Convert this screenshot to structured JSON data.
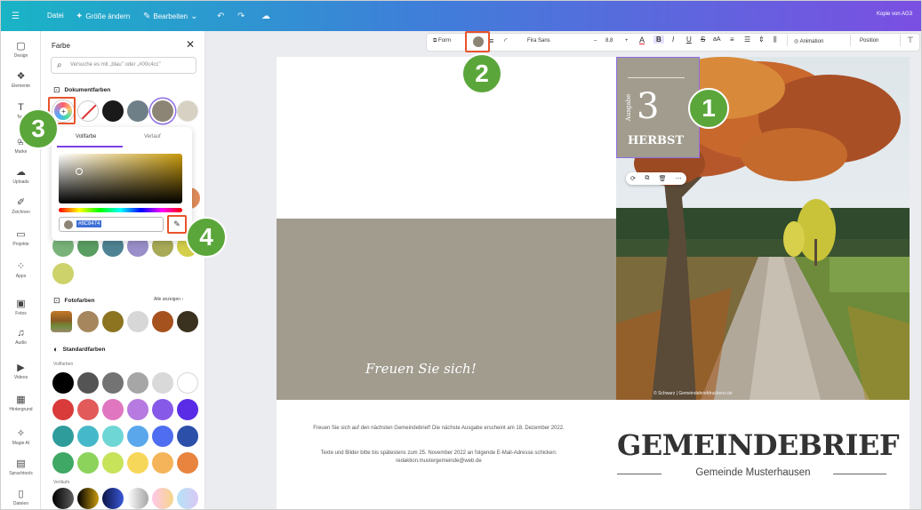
{
  "topbar": {
    "menu_icon": "hamburger-icon",
    "file": "Datei",
    "resize": "Größe ändern",
    "edit": "Bearbeiten",
    "user_label": "Kopie von AG3",
    "gradient": [
      "#19b4c6",
      "#3e7fd9",
      "#7b4fe2"
    ]
  },
  "rail": {
    "items": [
      {
        "label": "Design",
        "icon": "layout-icon"
      },
      {
        "label": "Elemente",
        "icon": "shapes-icon"
      },
      {
        "label": "Text",
        "icon": "text-icon"
      },
      {
        "label": "Marke",
        "icon": "crown-icon"
      },
      {
        "label": "Uploads",
        "icon": "cloud-icon"
      },
      {
        "label": "Zeichnen",
        "icon": "pen-icon"
      },
      {
        "label": "Projekte",
        "icon": "folder-icon"
      },
      {
        "label": "Apps",
        "icon": "apps-icon"
      },
      {
        "label": "Fotos",
        "icon": "photo-icon"
      },
      {
        "label": "Audio",
        "icon": "music-icon"
      },
      {
        "label": "Videos",
        "icon": "video-icon"
      },
      {
        "label": "Hintergrund",
        "icon": "background-icon"
      },
      {
        "label": "Magie AI",
        "icon": "magic-icon"
      },
      {
        "label": "Sprachtools",
        "icon": "language-icon"
      },
      {
        "label": "Dateien",
        "icon": "file-icon"
      }
    ]
  },
  "panel": {
    "title": "Farbe",
    "search_placeholder": "Versuche es mit „blau\" oder „#00c4cc\"",
    "doc_colors_label": "Dokumentfarben",
    "doc_colors": [
      "#1a1a1a",
      "#6f7f87",
      "#8c8474",
      "#d6d1c2"
    ],
    "picker": {
      "tab_solid": "Vollfarbe",
      "tab_gradient": "Verlauf",
      "hex": "#8C8474",
      "gradient_hue": "#c89a0d"
    },
    "hidden_row": [
      "#e08c5a"
    ],
    "doc_colors_row2": [
      "#79b37a",
      "#5a9e63",
      "#4f8393",
      "#9a8fc9",
      "#a9aa57",
      "#d3cf4a"
    ],
    "doc_colors_row3": [
      "#cdd26b"
    ],
    "photo_colors_label": "Fotofarben",
    "show_all": "Alle anzeigen",
    "photo_colors": [
      "#a6875d",
      "#8c7420",
      "#d7d7d7",
      "#a5521f",
      "#3a321e"
    ],
    "standard_colors_label": "Standardfarben",
    "solid_label": "Vollfarben",
    "standard_colors": [
      [
        "#000000",
        "#545454",
        "#737373",
        "#a6a6a6",
        "#d9d9d9",
        "#ffffff"
      ],
      [
        "#d93a3a",
        "#e25a5a",
        "#e176c0",
        "#b67ae0",
        "#8759e8",
        "#5a2ce6"
      ],
      [
        "#2f9c9c",
        "#45b9c9",
        "#6fd6d6",
        "#5aa7ec",
        "#4f6df0",
        "#2c4faa"
      ],
      [
        "#3fa864",
        "#8bd35a",
        "#c6e35a",
        "#f6d75a",
        "#f5b45a",
        "#e8843d"
      ]
    ],
    "gradients_label": "Verläufe",
    "gradients": [
      [
        "#000000",
        "#5e5e5e"
      ],
      [
        "#000000",
        "#c89a0d"
      ],
      [
        "#0b1447",
        "#3a59d6"
      ],
      [
        "#ffffff",
        "#a6a6a6"
      ],
      [
        "#ffc7ea",
        "#f5d58a"
      ],
      [
        "#b4e3f5",
        "#d9c8f5"
      ]
    ]
  },
  "canvas_toolbar": {
    "shape": "Form",
    "font": "Fira Sans",
    "font_size": "8,8",
    "minus": "–",
    "plus": "+",
    "animation": "Animation",
    "position": "Position",
    "fill_color": "#8c8474"
  },
  "document": {
    "band_color": "#a19c8e",
    "script_text": "Freuen Sie sich!",
    "badge_vertical": "Ausgabe",
    "badge_number": "3",
    "badge_season": "HERBST",
    "photo_credit": "© Schwarz | Gemeindebriefdruckerei.de",
    "info1": "Freuen Sie sich auf den nächsten Gemeindebrief! Die nächste Ausgabe erscheint am 18. Dezember 2022.",
    "info2": "Texte und Bilder bitte bis spätestens zum 25. November 2022 an folgende E-Mail-Adresse schicken: redaktion.mustergemeinde@web.de",
    "title": "GEMEINDEBRIEF",
    "subtitle": "Gemeinde Musterhausen"
  },
  "callouts": [
    "1",
    "2",
    "3",
    "4"
  ],
  "callout_color": "#5ba63a",
  "highlight_color": "#e8542d"
}
